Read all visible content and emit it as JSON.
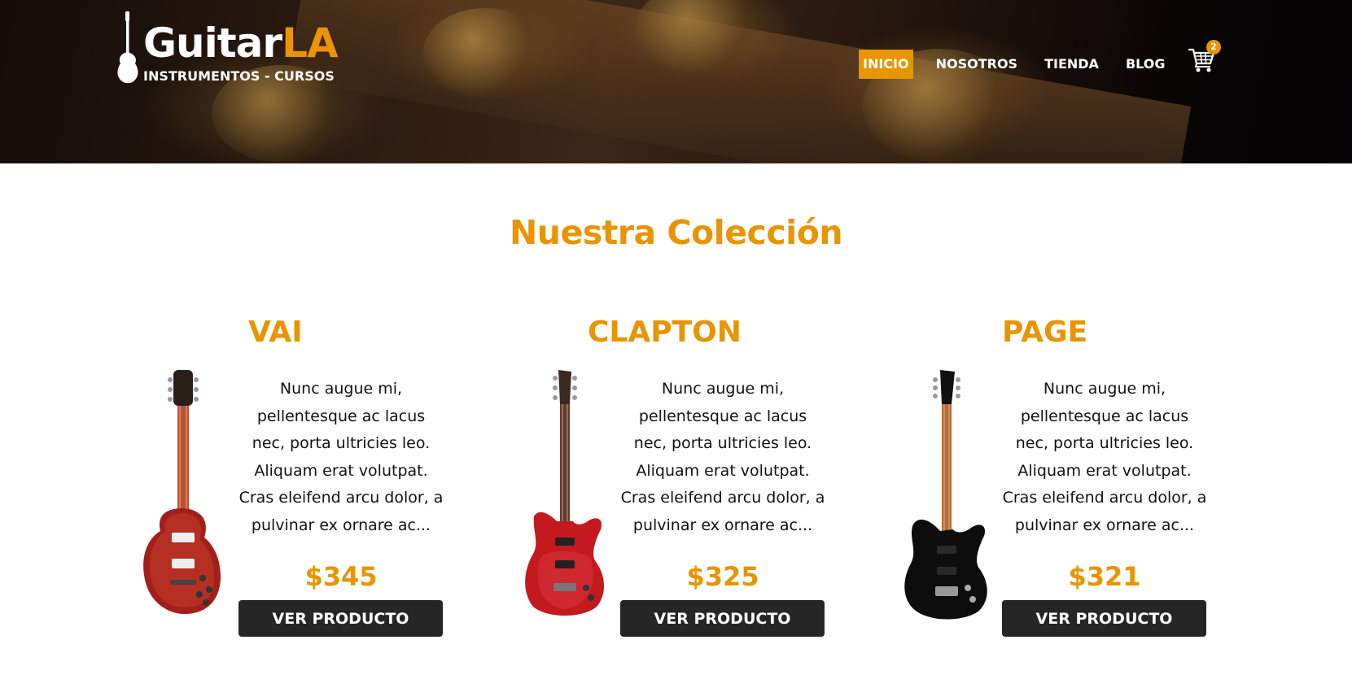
{
  "header": {
    "logo": {
      "title_main": "Guitar",
      "title_accent": "LA",
      "subtitle": "INSTRUMENTOS - CURSOS"
    },
    "nav": [
      {
        "label": "INICIO",
        "active": true
      },
      {
        "label": "NOSOTROS",
        "active": false
      },
      {
        "label": "TIENDA",
        "active": false
      },
      {
        "label": "BLOG",
        "active": false
      }
    ],
    "cart": {
      "icon": "cart-icon",
      "count": "2"
    }
  },
  "main": {
    "title": "Nuestra Colección",
    "products": [
      {
        "name": "VAI",
        "description": "Nunc augue mi, pellentesque ac lacus nec, porta ultricies leo. Aliquam erat volutpat. Cras eleifend arcu dolor, a pulvinar ex ornare ac...",
        "price": "$345",
        "button_label": "VER PRODUCTO",
        "image": "les-paul-guitar-red"
      },
      {
        "name": "CLAPTON",
        "description": "Nunc augue mi, pellentesque ac lacus nec, porta ultricies leo. Aliquam erat volutpat. Cras eleifend arcu dolor, a pulvinar ex ornare ac...",
        "price": "$325",
        "button_label": "VER PRODUCTO",
        "image": "superstrat-guitar-red"
      },
      {
        "name": "PAGE",
        "description": "Nunc augue mi, pellentesque ac lacus nec, porta ultricies leo. Aliquam erat volutpat. Cras eleifend arcu dolor, a pulvinar ex ornare ac...",
        "price": "$321",
        "button_label": "VER PRODUCTO",
        "image": "superstrat-guitar-black"
      }
    ]
  },
  "colors": {
    "accent": "#e99401",
    "button_bg": "#262626",
    "text": "#111111",
    "background": "#ffffff"
  }
}
